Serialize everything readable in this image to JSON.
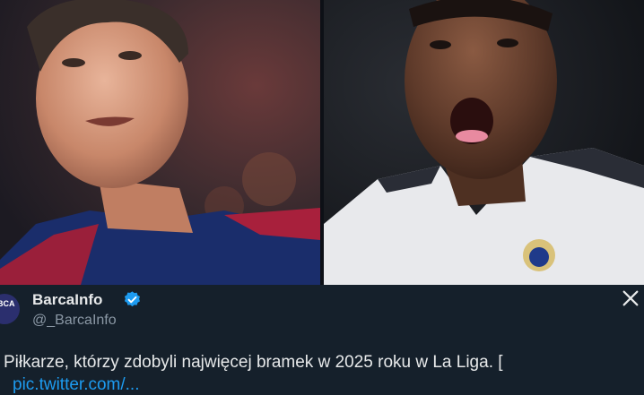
{
  "media": {
    "left_photo": {
      "alt": "lewandowski-photo"
    },
    "right_photo": {
      "alt": "mbappe-photo"
    }
  },
  "tweet": {
    "author_name": "BarcaInfo",
    "handle": "@_BarcaInfo",
    "avatar_text": "BCA",
    "text": "Piłkarze, którzy zdobyli najwięcej bramek w 2025 roku w La Liga. [",
    "link_text": "pic.twitter.com/...",
    "verified_icon": "verified-badge-icon",
    "brand_icon": "x-logo-icon"
  },
  "colors": {
    "background": "#15202b",
    "text": "#e7e9ea",
    "secondary": "#8b98a5",
    "accent": "#1d9bf0"
  }
}
